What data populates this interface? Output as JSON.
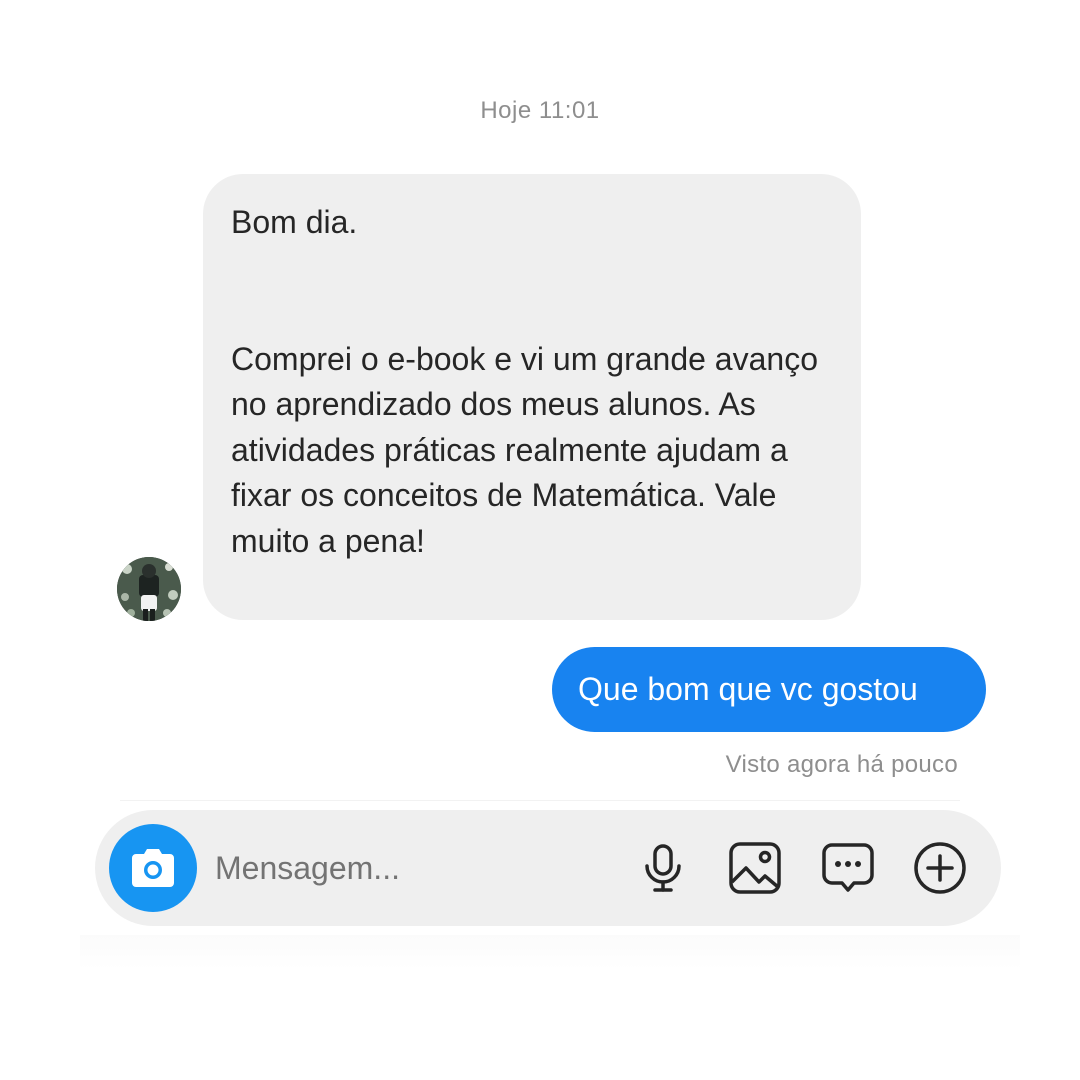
{
  "conversation": {
    "timestamp": "Hoje 11:01",
    "incoming": {
      "avatar_icon": "user-avatar",
      "greeting": "Bom dia.",
      "body": "Comprei o e-book e vi um grande avanço no aprendizado dos meus alunos. As atividades práticas realmente ajudam a fixar os conceitos de Matemática. Vale muito a pena!"
    },
    "outgoing": {
      "text": "Que bom que vc gostou"
    },
    "seen_status": "Visto agora há pouco"
  },
  "composer": {
    "placeholder": "Mensagem...",
    "icons": [
      "camera-icon",
      "microphone-icon",
      "gallery-icon",
      "sticker-icon",
      "plus-circle-icon"
    ]
  },
  "colors": {
    "outgoing_bubble": "#1883f0",
    "camera_button": "#1795f2",
    "incoming_bubble": "#efefef",
    "meta_text": "#8e8e8e"
  }
}
